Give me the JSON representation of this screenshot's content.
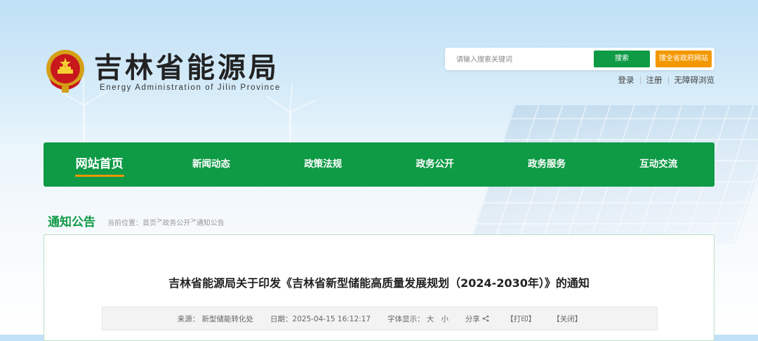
{
  "header": {
    "title_cn": "吉林省能源局",
    "title_en": "Energy Administration of Jilin Province",
    "search": {
      "placeholder": "请输入搜索关键词",
      "search_label": "搜索",
      "search_all_label": "搜全省政府网站"
    },
    "user_links": [
      "登录",
      "注册",
      "无障碍浏览"
    ]
  },
  "nav": {
    "items": [
      {
        "label": "网站首页",
        "active": true
      },
      {
        "label": "新闻动态",
        "active": false
      },
      {
        "label": "政策法规",
        "active": false
      },
      {
        "label": "政务公开",
        "active": false
      },
      {
        "label": "政务服务",
        "active": false
      },
      {
        "label": "互动交流",
        "active": false
      }
    ]
  },
  "section": {
    "title": "通知公告",
    "breadcrumb_prefix": "当前位置：",
    "breadcrumb": [
      "首页",
      "政务公开",
      "通知公告"
    ],
    "breadcrumb_sep": ">"
  },
  "article": {
    "title": "吉林省能源局关于印发《吉林省新型储能高质量发展规划（2024-2030年）》的通知",
    "meta": {
      "source": "来源：  新型储能转化处",
      "date": "日期：2025-04-15 16:12:17",
      "font_label": "字体显示：",
      "font_large": "大",
      "font_small": "小",
      "share": "分享",
      "print": "【打印】",
      "close": "【关闭】"
    }
  },
  "colors": {
    "brand_green": "#0f9a46",
    "accent_orange": "#f39800"
  },
  "icons": {
    "emblem": "national-emblem-icon",
    "share": "share-icon"
  }
}
